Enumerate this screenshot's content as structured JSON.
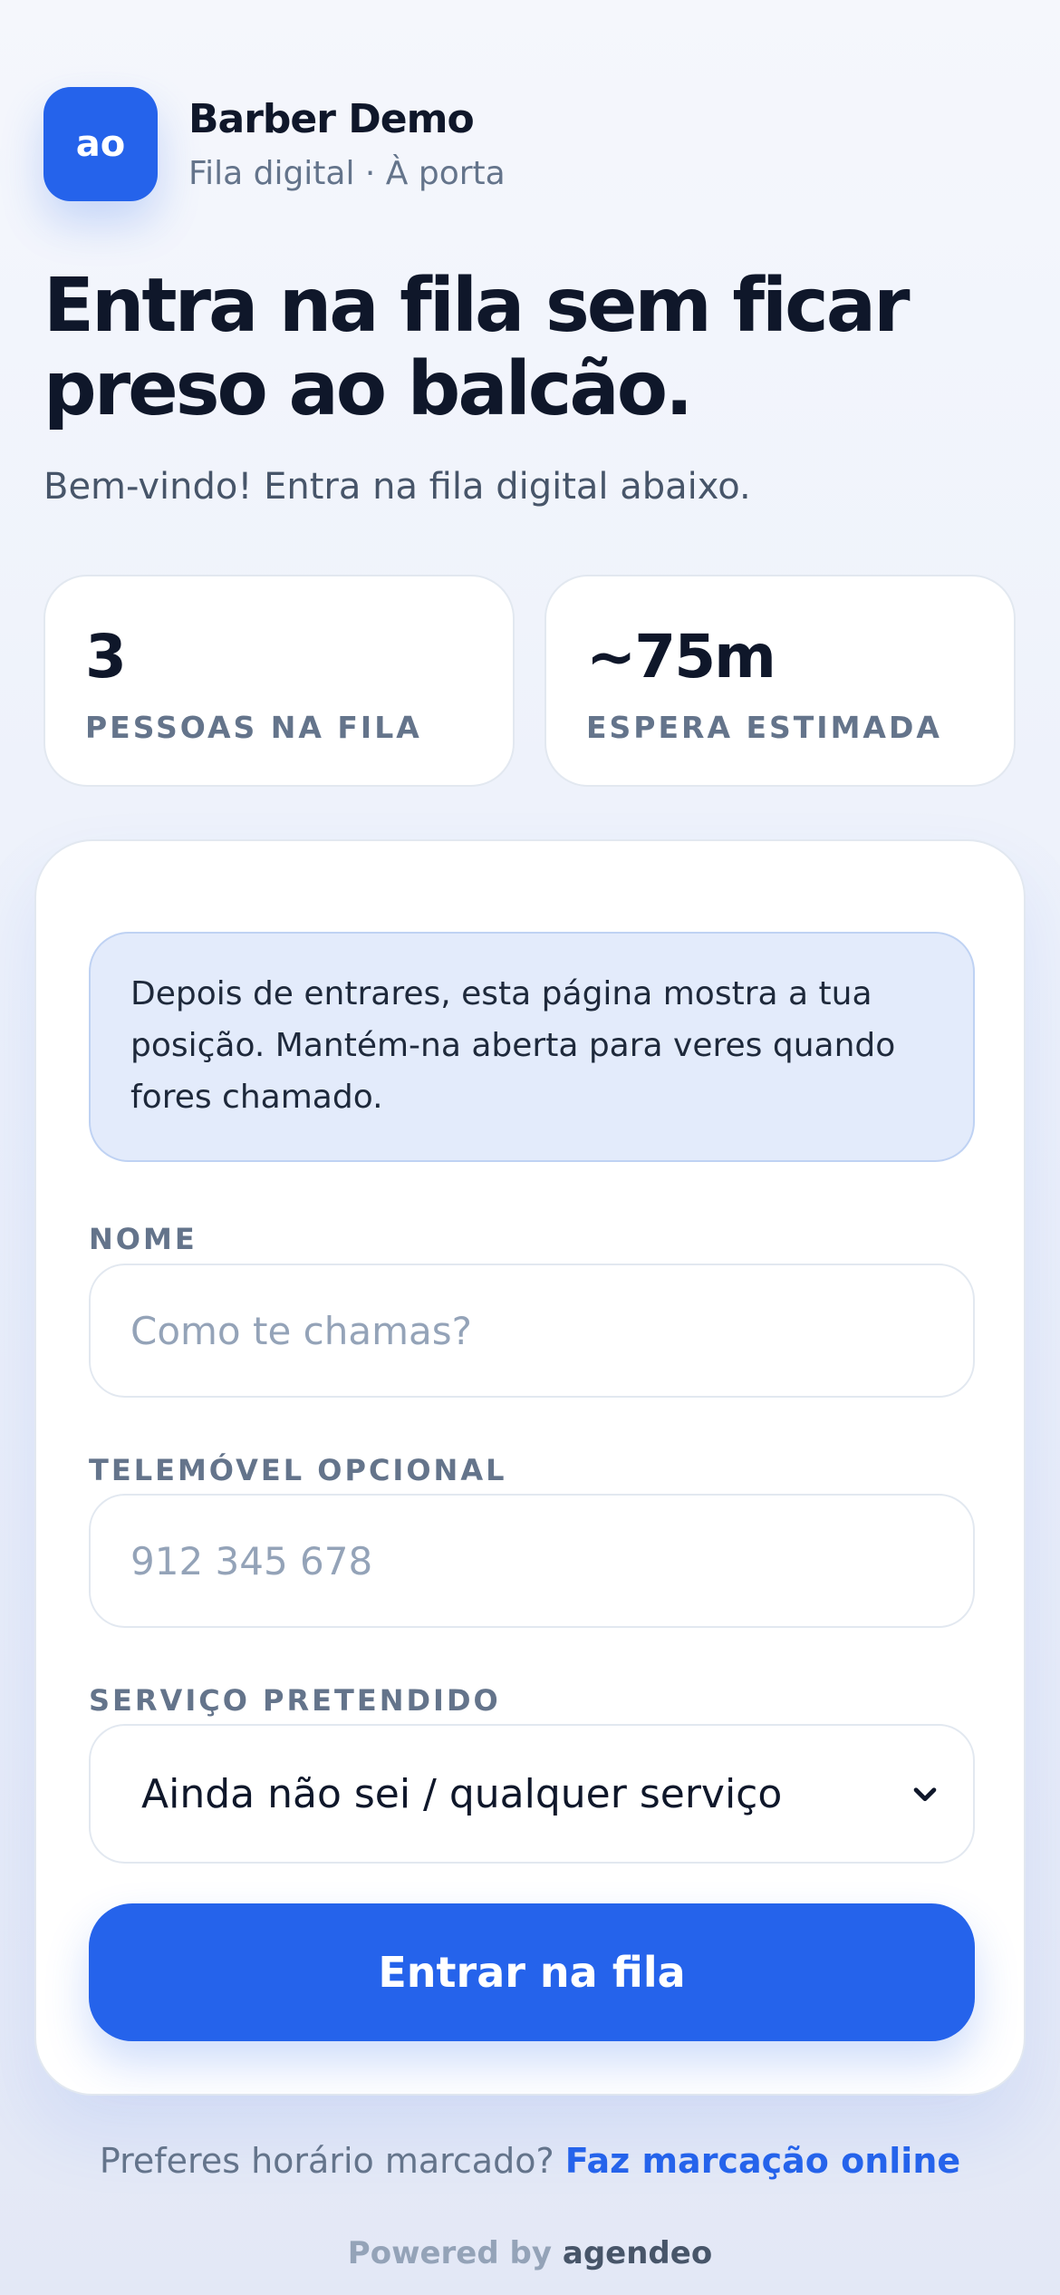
{
  "brand": {
    "logo_text": "ao",
    "name": "Barber Demo",
    "subtitle": "Fila digital · À porta"
  },
  "hero": {
    "title": "Entra na fila sem ficar preso ao balcão.",
    "subtitle": "Bem-vindo! Entra na fila digital abaixo."
  },
  "stats": [
    {
      "value": "3",
      "label": "PESSOAS NA FILA"
    },
    {
      "value": "~75m",
      "label": "ESPERA ESTIMADA"
    }
  ],
  "form": {
    "notice": "Depois de entrares, esta página mostra a tua posição. Mantém-na aberta para veres quando fores chamado.",
    "name_label": "NOME",
    "name_placeholder": "Como te chamas?",
    "phone_label": "TELEMÓVEL OPCIONAL",
    "phone_placeholder": "912 345 678",
    "service_label": "SERVIÇO PRETENDIDO",
    "service_selected": "Ainda não sei / qualquer serviço",
    "submit_label": "Entrar na fila"
  },
  "footer": {
    "question": "Preferes horário marcado?",
    "link": "Faz marcação online",
    "powered_prefix": "Powered by",
    "powered_brand": "agendeo"
  },
  "colors": {
    "accent": "#2563eb",
    "notice_bg": "#e3ebfb",
    "text_primary": "#0f172a",
    "text_muted": "#64748b"
  }
}
